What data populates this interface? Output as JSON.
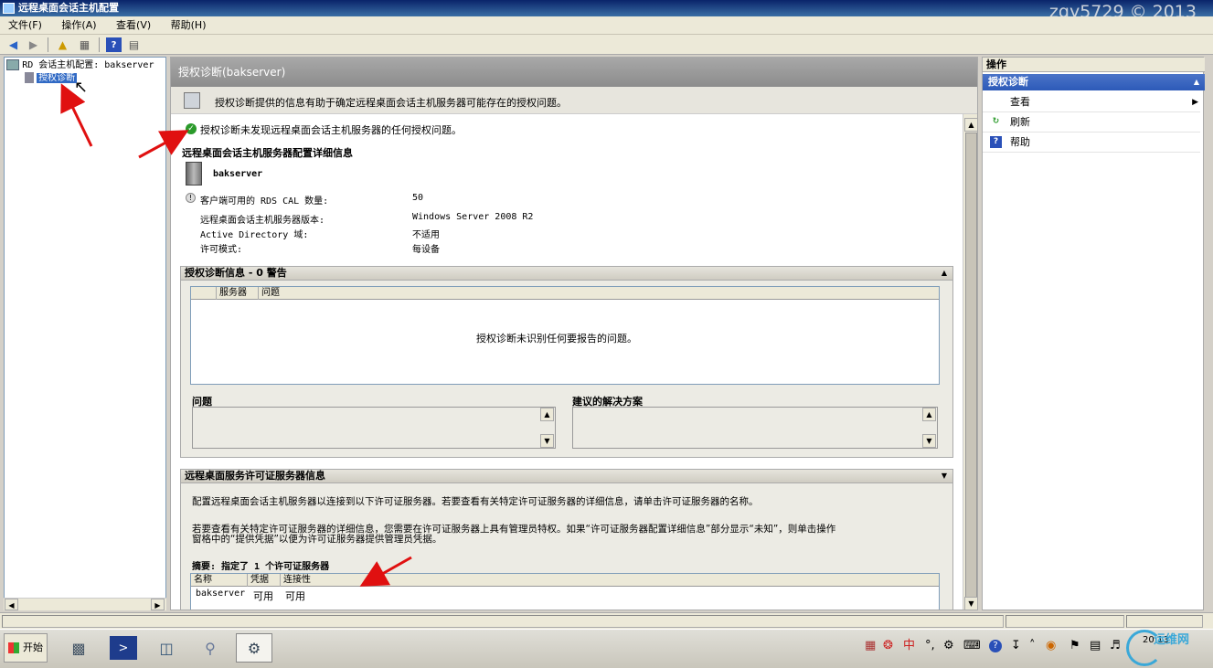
{
  "window": {
    "title": "远程桌面会话主机配置",
    "watermark": "zgy5729 © 2013"
  },
  "menu": {
    "items": [
      "文件(F)",
      "操作(A)",
      "查看(V)",
      "帮助(H)"
    ]
  },
  "tree": {
    "root_label": "RD 会话主机配置: bakserver",
    "child_label": "授权诊断"
  },
  "center": {
    "header": "授权诊断(bakserver)",
    "description": "授权诊断提供的信息有助于确定远程桌面会话主机服务器可能存在的授权问题。",
    "status_message": "授权诊断未发现远程桌面会话主机服务器的任何授权问题。",
    "details_title": "远程桌面会话主机服务器配置详细信息",
    "server_name": "bakserver",
    "details": [
      {
        "label": "客户端可用的 RDS CAL 数量:",
        "value": "50"
      },
      {
        "label": "远程桌面会话主机服务器版本:",
        "value": "Windows Server 2008 R2"
      },
      {
        "label": "Active Directory 域:",
        "value": "不适用"
      },
      {
        "label": "许可模式:",
        "value": "每设备"
      }
    ],
    "diag_section": {
      "title": "授权诊断信息 - 0 警告",
      "columns": [
        "",
        "服务器",
        "问题"
      ],
      "empty_message": "授权诊断未识别任何要报告的问题。",
      "problem_label": "问题",
      "solution_label": "建议的解决方案"
    },
    "license_section": {
      "title": "远程桌面服务许可证服务器信息",
      "para1": "配置远程桌面会话主机服务器以连接到以下许可证服务器。若要查看有关特定许可证服务器的详细信息，请单击许可证服务器的名称。",
      "para2_line1": "若要查看有关特定许可证服务器的详细信息，您需要在许可证服务器上具有管理员特权。如果“许可证服务器配置详细信息”部分显示“未知”，则单击操作",
      "para2_line2": "窗格中的“提供凭据”以便为许可证服务器提供管理员凭据。",
      "summary": "摘要: 指定了 1 个许可证服务器",
      "columns": [
        "名称",
        "凭据",
        "连接性"
      ],
      "rows": [
        {
          "name": "bakserver",
          "credentials": "可用",
          "connectivity": "可用"
        }
      ]
    }
  },
  "actions": {
    "title": "操作",
    "group": "授权诊断",
    "items": [
      {
        "label": "查看",
        "icon": "none"
      },
      {
        "label": "刷新",
        "icon": "refresh-icon"
      },
      {
        "label": "帮助",
        "icon": "help-icon"
      }
    ]
  },
  "taskbar": {
    "start_label": "开始",
    "tray_ime": "中",
    "clock_line1": "20:13",
    "watermark_text": "运维网"
  }
}
